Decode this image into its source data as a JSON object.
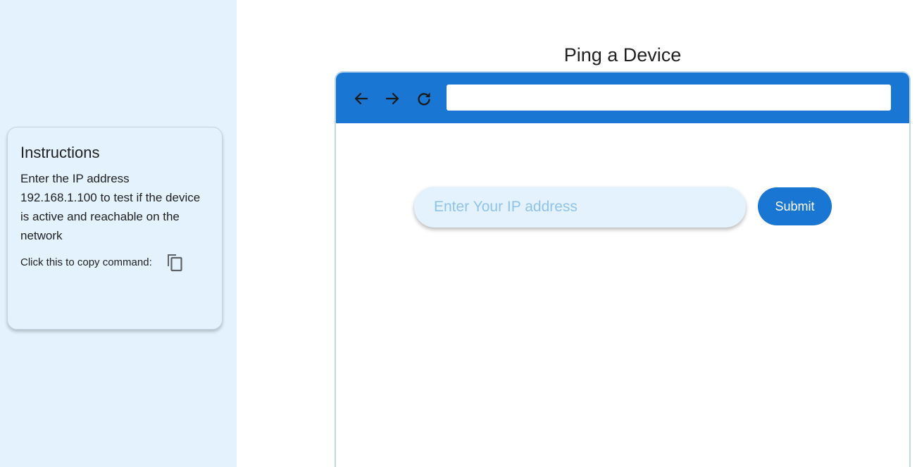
{
  "sidebar": {
    "instructions": {
      "title": "Instructions",
      "body": "Enter the IP address 192.168.1.100 to test if the device is active and reachable on the network",
      "copy_label": "Click this to copy command:",
      "copy_icon": "copy-icon"
    }
  },
  "main": {
    "title": "Ping a Device",
    "browser": {
      "nav": {
        "back_icon": "arrow-left-icon",
        "forward_icon": "arrow-right-icon",
        "reload_icon": "refresh-icon"
      },
      "url_value": "",
      "ip_input": {
        "placeholder": "Enter Your IP address",
        "value": ""
      },
      "submit_label": "Submit"
    }
  },
  "colors": {
    "sidebar_bg": "#e3f2fd",
    "primary": "#1976d2",
    "input_bg": "#e3f2fd",
    "placeholder": "#90c3ec"
  }
}
